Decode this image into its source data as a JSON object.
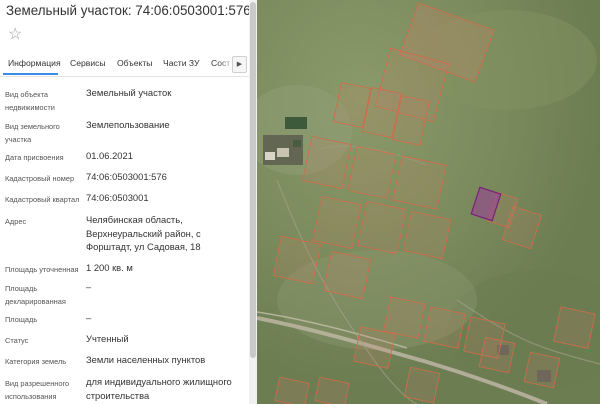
{
  "panel": {
    "title": "Земельный участок: 74:06:0503001:576",
    "star_icon": "star-outline-icon",
    "tabs": [
      "Информация",
      "Сервисы",
      "Объекты",
      "Части ЗУ",
      "Сост"
    ],
    "tab_scroll_icon": "chevron-right-icon",
    "rows": [
      {
        "label": "Вид объекта недвижимости",
        "value": "Земельный участок"
      },
      {
        "label": "Вид земельного участка",
        "value": "Землепользование"
      },
      {
        "label": "Дата присвоения",
        "value": "01.06.2021"
      },
      {
        "label": "Кадастровый номер",
        "value": "74:06:0503001:576"
      },
      {
        "label": "Кадастровый квартал",
        "value": "74:06:0503001"
      },
      {
        "label": "Адрес",
        "value": "Челябинская область, Верхнеуральский район, с Форштадт, ул Садовая, 18"
      },
      {
        "label": "Площадь уточненная",
        "value": "1 200 кв. м"
      },
      {
        "label": "Площадь декларированная",
        "value": "–"
      },
      {
        "label": "Площадь",
        "value": "–"
      },
      {
        "label": "Статус",
        "value": "Учтенный"
      },
      {
        "label": "Категория земель",
        "value": "Земли населенных пунктов"
      },
      {
        "label": "Вид разрешенного использования",
        "value": "для индивидуального жилищного строительства"
      }
    ]
  },
  "map": {
    "colors": {
      "terrain": "#7d8d5f",
      "parcel_outline": "#d46a4a",
      "selected_parcel": "#8a2a8a"
    }
  }
}
